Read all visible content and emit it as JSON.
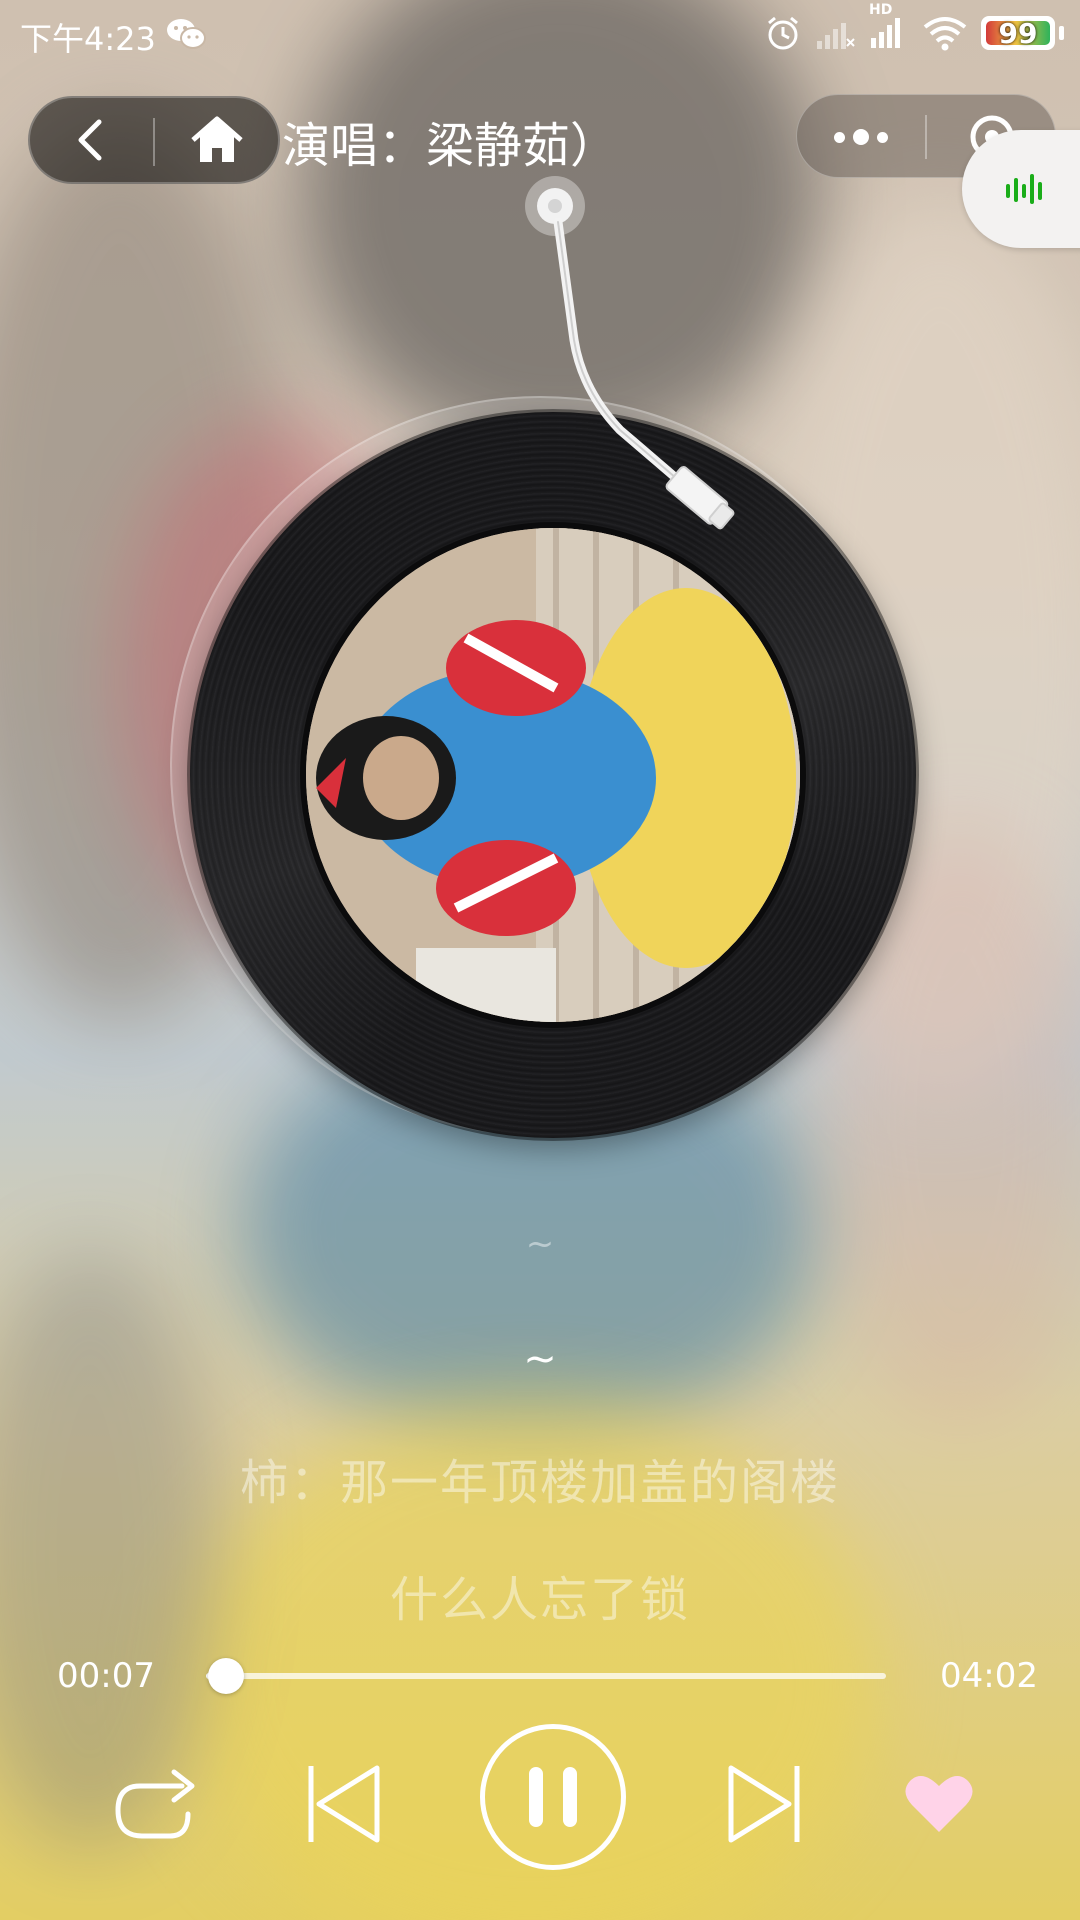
{
  "status_bar": {
    "time": "下午4:23",
    "battery": "99",
    "network_label": "HD",
    "icons": [
      "wechat-icon",
      "alarm-icon",
      "signal-off-icon",
      "signal-icon",
      "wifi-icon",
      "battery-icon"
    ]
  },
  "nav": {
    "title": "演唱：梁静茹）",
    "back_icon": "chevron-left-icon",
    "home_icon": "home-icon",
    "more_icon": "more-dots-icon",
    "close_icon": "target-close-icon"
  },
  "floating_tab": {
    "icon": "audio-wave-icon",
    "accent": "#1aad19"
  },
  "album": {
    "art_icon": "album-cover"
  },
  "lyrics": {
    "prev_prev": "~",
    "prev": "~",
    "current": "柿：那一年顶楼加盖的阁楼",
    "next": "什么人忘了锁"
  },
  "progress": {
    "current": "00:07",
    "total": "04:02",
    "fraction": 0.029
  },
  "controls": {
    "repeat_icon": "repeat-icon",
    "prev_icon": "skip-previous-icon",
    "play_icon": "pause-icon",
    "next_icon": "skip-next-icon",
    "like_icon": "heart-icon",
    "like_color": "#ffd3e8"
  }
}
